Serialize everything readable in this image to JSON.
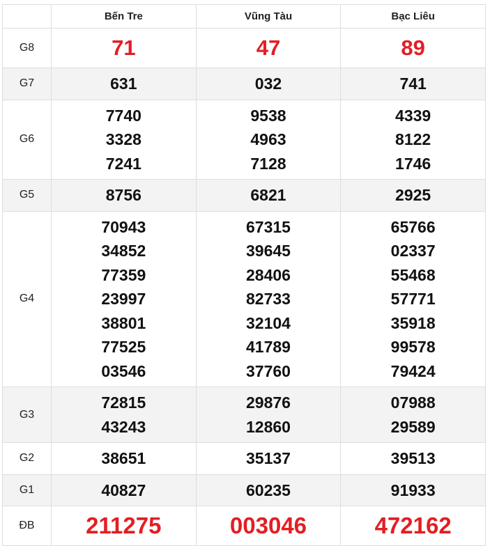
{
  "provinces": [
    "Bến Tre",
    "Vũng Tàu",
    "Bạc Liêu"
  ],
  "colors": {
    "special": "#e31e24",
    "text": "#111111",
    "stripe": "#f3f3f3",
    "border": "#dddddd"
  },
  "rows": [
    {
      "prize": "G8",
      "style": "special-g8",
      "shade": false,
      "values": [
        [
          "71"
        ],
        [
          "47"
        ],
        [
          "89"
        ]
      ]
    },
    {
      "prize": "G7",
      "style": "normal",
      "shade": true,
      "values": [
        [
          "631"
        ],
        [
          "032"
        ],
        [
          "741"
        ]
      ]
    },
    {
      "prize": "G6",
      "style": "normal",
      "shade": false,
      "values": [
        [
          "7740",
          "3328",
          "7241"
        ],
        [
          "9538",
          "4963",
          "7128"
        ],
        [
          "4339",
          "8122",
          "1746"
        ]
      ]
    },
    {
      "prize": "G5",
      "style": "normal",
      "shade": true,
      "values": [
        [
          "8756"
        ],
        [
          "6821"
        ],
        [
          "2925"
        ]
      ]
    },
    {
      "prize": "G4",
      "style": "normal",
      "shade": false,
      "values": [
        [
          "70943",
          "34852",
          "77359",
          "23997",
          "38801",
          "77525",
          "03546"
        ],
        [
          "67315",
          "39645",
          "28406",
          "82733",
          "32104",
          "41789",
          "37760"
        ],
        [
          "65766",
          "02337",
          "55468",
          "57771",
          "35918",
          "99578",
          "79424"
        ]
      ]
    },
    {
      "prize": "G3",
      "style": "normal",
      "shade": true,
      "values": [
        [
          "72815",
          "43243"
        ],
        [
          "29876",
          "12860"
        ],
        [
          "07988",
          "29589"
        ]
      ]
    },
    {
      "prize": "G2",
      "style": "normal",
      "shade": false,
      "values": [
        [
          "38651"
        ],
        [
          "35137"
        ],
        [
          "39513"
        ]
      ]
    },
    {
      "prize": "G1",
      "style": "normal",
      "shade": true,
      "values": [
        [
          "40827"
        ],
        [
          "60235"
        ],
        [
          "91933"
        ]
      ]
    },
    {
      "prize": "ĐB",
      "style": "special-db",
      "shade": false,
      "values": [
        [
          "211275"
        ],
        [
          "003046"
        ],
        [
          "472162"
        ]
      ]
    }
  ]
}
